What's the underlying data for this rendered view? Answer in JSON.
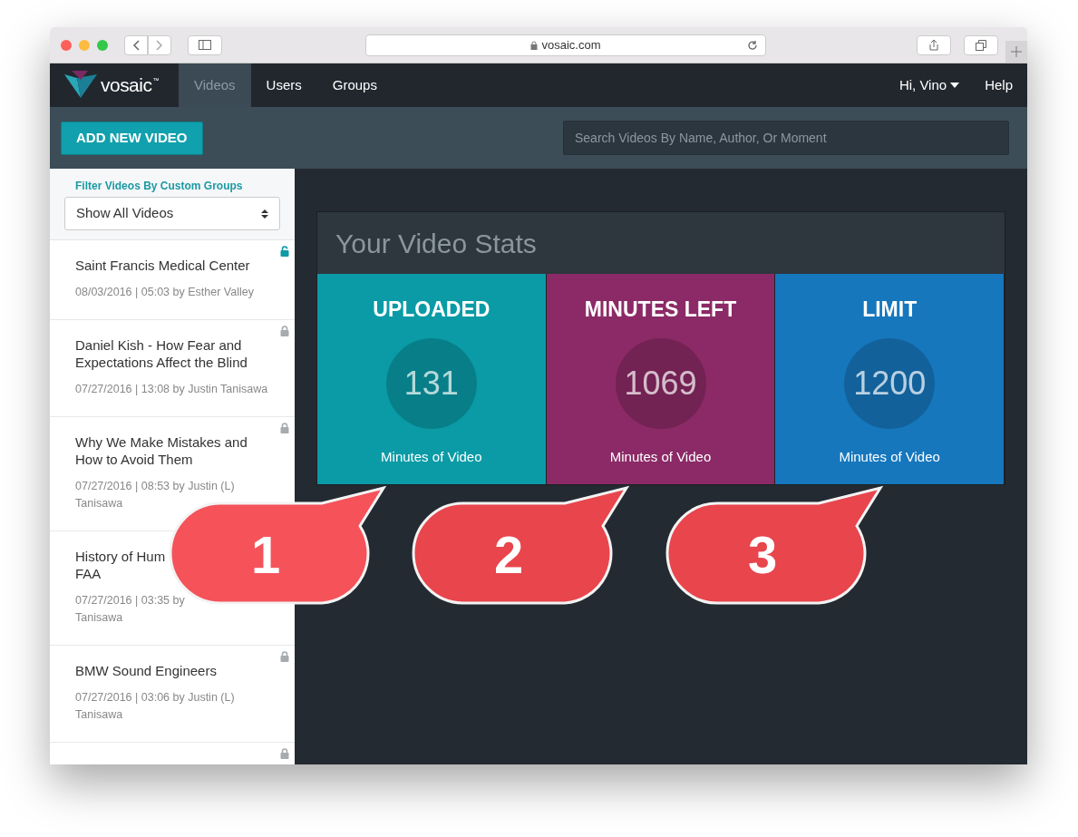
{
  "browser": {
    "address": "vosaic.com"
  },
  "logo": {
    "wordmark": "vosaic",
    "trademark": "™"
  },
  "nav": {
    "items": [
      {
        "label": "Videos",
        "selected": true
      },
      {
        "label": "Users",
        "selected": false
      },
      {
        "label": "Groups",
        "selected": false
      }
    ],
    "user": "Hi, Vino",
    "help": "Help"
  },
  "toolbar": {
    "add_button": "ADD NEW VIDEO",
    "search": {
      "placeholder": "Search Videos By Name, Author, Or Moment"
    }
  },
  "sidebar": {
    "filter_label": "Filter Videos By Custom Groups",
    "filter_value": "Show All Videos",
    "videos": [
      {
        "title": "Saint Francis Medical Center",
        "meta": "08/03/2016 | 05:03 by Esther Valley",
        "locked": false
      },
      {
        "title": "Daniel Kish - How Fear and Expectations Affect the Blind",
        "meta": "07/27/2016 | 13:08 by Justin Tanisawa",
        "locked": true
      },
      {
        "title": "Why We Make Mistakes and How to Avoid Them",
        "meta": "07/27/2016 | 08:53 by Justin (L) Tanisawa",
        "locked": true
      },
      {
        "title": "History of Hum",
        "title_continued": "FAA",
        "meta": "07/27/2016 | 03:35 by",
        "meta_continued": "Tanisawa"
      },
      {
        "title": "BMW Sound Engineers",
        "meta": "07/27/2016 | 03:06 by Justin (L) Tanisawa",
        "locked": true
      },
      {
        "locked": true
      }
    ]
  },
  "stats": {
    "title": "Your Video Stats",
    "tiles": [
      {
        "label": "UPLOADED",
        "value": "131",
        "caption": "Minutes of Video",
        "color": "#0a9ba6"
      },
      {
        "label": "MINUTES LEFT",
        "value": "1069",
        "caption": "Minutes of Video",
        "color": "#8b2a66"
      },
      {
        "label": "LIMIT",
        "value": "1200",
        "caption": "Minutes of Video",
        "color": "#1677bd"
      }
    ]
  },
  "callouts": [
    "1",
    "2",
    "3"
  ]
}
